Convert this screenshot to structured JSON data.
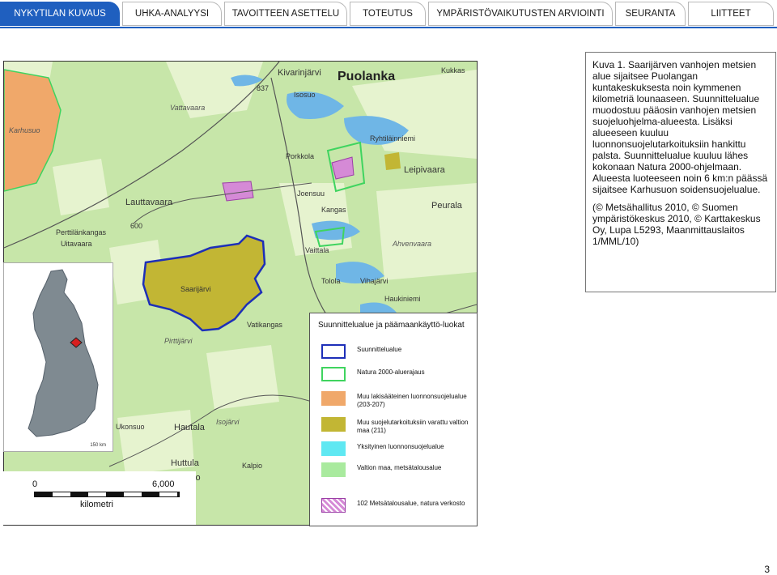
{
  "tabs": [
    {
      "label": "NYKYTILAN KUVAUS",
      "active": true
    },
    {
      "label": "UHKA-ANALYYSI",
      "active": false
    },
    {
      "label": "TAVOITTEEN ASETTELU",
      "active": false
    },
    {
      "label": "TOTEUTUS",
      "active": false
    },
    {
      "label": "YMPÄRISTÖVAIKUTUSTEN ARVIOINTI",
      "active": false
    },
    {
      "label": "SEURANTA",
      "active": false
    },
    {
      "label": "LIITTEET",
      "active": false
    }
  ],
  "colors": {
    "accent": "#1f5fbf",
    "forest_bg": "#c7e6a9",
    "light_green": "#e6f3cf",
    "water": "#6fb6e6",
    "planning_area": "#c2b634",
    "other_protected": "#f0a86a",
    "natura_border": "#3fd45f",
    "boundary_blue": "#1d2fb8"
  },
  "map": {
    "labels": [
      "Puolanka",
      "Kivarinjärvi",
      "Ryhtiläinniemi",
      "Leipivaara",
      "Porkkola",
      "Lauttavaara",
      "Saarijärvi",
      "Vaittala",
      "Tolola",
      "Vihajärvi",
      "Haukiniemi",
      "Peurala",
      "Ahvenvaara",
      "Joensuu",
      "Kangas",
      "Huttula",
      "Kalpio",
      "Pirttijärvi",
      "Ukonsuo",
      "Hautala",
      "Vatikangas",
      "Isosuo",
      "Kukkas",
      "Vattavaara",
      "Karhusuo",
      "Perttilänkangas",
      "Uitavaara",
      "Kalpio",
      "Isojärvi"
    ],
    "road_numbers": [
      "837",
      "600"
    ],
    "inset_scale": "150 km",
    "scale": {
      "start": "0",
      "end": "6,000",
      "unit": "kilometri"
    }
  },
  "legend": {
    "title": "Suunnittelualue ja päämaankäyttö-luokat",
    "items": [
      {
        "label": "Suunnittelualue",
        "icon": "planning-area-swatch"
      },
      {
        "label": "Natura 2000-aluerajaus",
        "icon": "natura-swatch"
      },
      {
        "label": "Muu lakisääteinen luonnonsuojelualue (203-207)",
        "icon": "other-protected-swatch"
      },
      {
        "label": "Muu suojelutarkoituksiin varattu valtion maa (211)",
        "icon": "reserved-swatch"
      },
      {
        "label": "Yksityinen luonnonsuojelualue",
        "icon": "private-protected-swatch"
      },
      {
        "label": "Valtion maa, metsätalousalue",
        "icon": "state-forest-swatch"
      },
      {
        "label": "102 Metsätalousalue, natura verkosto",
        "icon": "forestry-natura-swatch"
      }
    ]
  },
  "caption": {
    "p1": "Kuva 1. Saarijärven vanhojen metsien alue sijaitsee Puolangan kuntakeskuksesta noin kymmenen kilometriä lounaaseen. Suunnittelualue muodostuu pääosin vanhojen metsien suojeluohjelma-alueesta. Lisäksi alueeseen kuuluu luonnonsuojelutarkoituksiin hankittu palsta. Suunnittelualue kuuluu lähes kokonaan Natura 2000-ohjelmaan. Alueesta luoteeseen noin 6 km:n päässä sijaitsee Karhusuon soidensuojelualue.",
    "p2": "(© Metsähallitus 2010, © Suomen ympäristökeskus 2010, © Karttakeskus Oy, Lupa L5293, Maanmittauslaitos 1/MML/10)"
  },
  "page_number": "3"
}
